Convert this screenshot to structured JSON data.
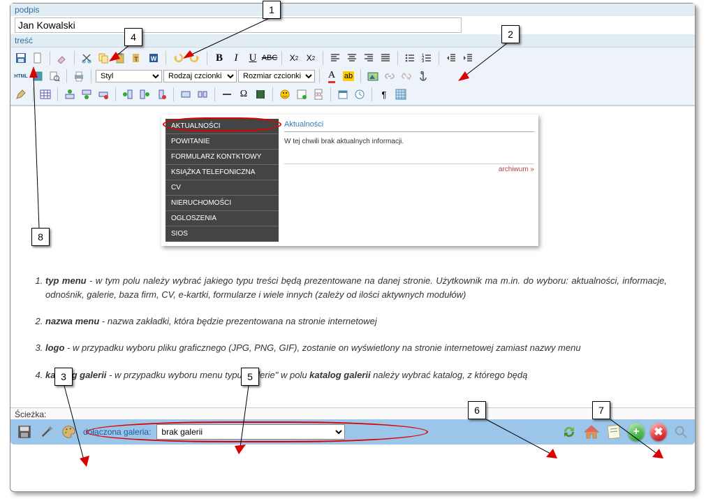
{
  "labels": {
    "podpis": "podpis",
    "tresc": "treść",
    "sciezka": "Ścieżka:"
  },
  "fields": {
    "podpis_value": "Jan Kowalski"
  },
  "toolbar": {
    "styl": "Styl",
    "font_family": "Rodzaj czcionki",
    "font_size": "Rozmiar czcionki"
  },
  "preview": {
    "menu": [
      "AKTUALNOŚCI",
      "POWITANIE",
      "FORMULARZ KONTKTOWY",
      "KSIĄŻKA TELEFONICZNA",
      "CV",
      "NIERUCHOMOŚCI",
      "OGLOSZENIA",
      "SIOS"
    ],
    "header": "Aktualności",
    "body": "W tej chwili brak aktualnych informacji.",
    "archive": "archiwum »"
  },
  "list": {
    "i1a": "typ menu",
    "i1b": " - w tym polu należy wybrać jakiego typu treści będą prezentowane na danej stronie. Użytkownik ma m.in. do wyboru: aktualności, informacje, odnośnik, galerie, baza firm, CV, e-kartki, formularze i wiele innych (zależy od ilości aktywnych modułów)",
    "i2a": "nazwa menu",
    "i2b": " - nazwa zakładki, która będzie prezentowana na stronie internetowej",
    "i3a": "logo",
    "i3b": " - w przypadku wyboru pliku graficznego (JPG, PNG, GIF), zostanie on wyświetlony na stronie internetowej zamiast nazwy menu",
    "i4a": "katalog galerii",
    "i4b_pre": " - w przypadku wyboru menu typu „galerie\" w polu ",
    "i4b_bold": "katalog galerii",
    "i4b_post": " należy wybrać katalog, z którego będą"
  },
  "bottom": {
    "gal_label": "dołączona galeria:",
    "gal_value": "brak galerii"
  },
  "callouts": {
    "1": "1",
    "2": "2",
    "3": "3",
    "4": "4",
    "5": "5",
    "6": "6",
    "7": "7",
    "8": "8"
  }
}
